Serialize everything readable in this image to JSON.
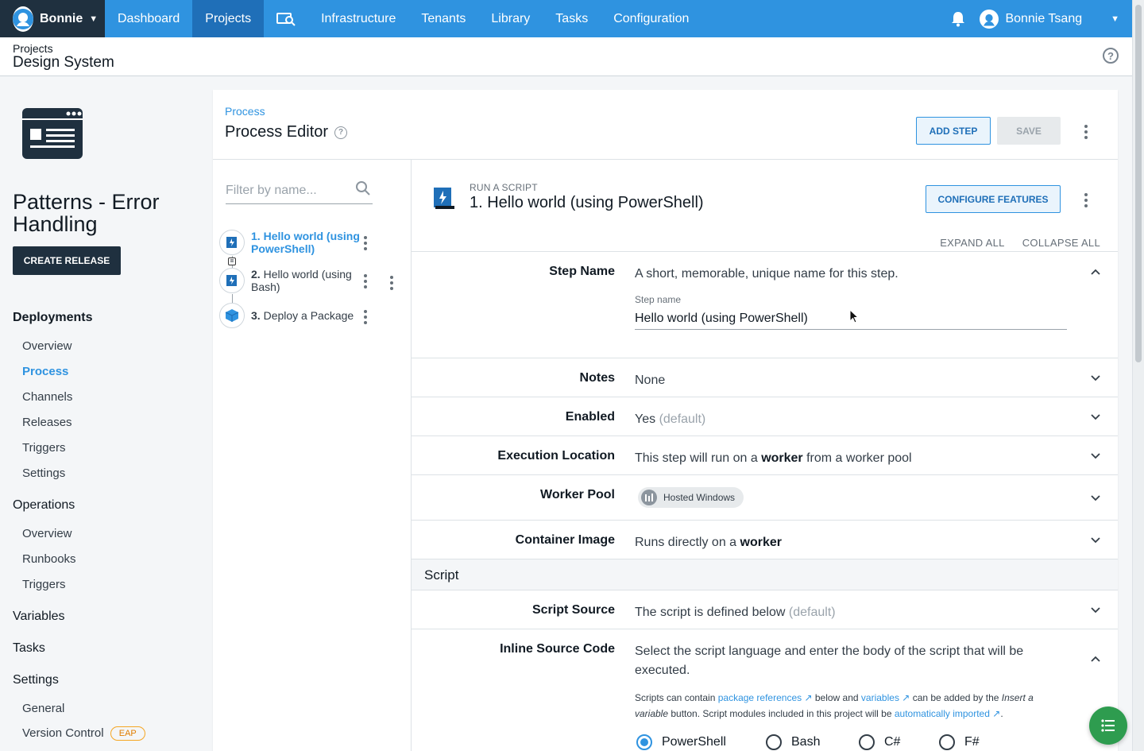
{
  "nav": {
    "brand": "Bonnie",
    "items": [
      {
        "label": "Dashboard"
      },
      {
        "label": "Projects"
      },
      {
        "label": "Infrastructure"
      },
      {
        "label": "Tenants"
      },
      {
        "label": "Library"
      },
      {
        "label": "Tasks"
      },
      {
        "label": "Configuration"
      }
    ],
    "search_icon": "search-machines-icon",
    "user_name": "Bonnie Tsang",
    "accent": "#2f93e0",
    "active_color": "#1f6fb8",
    "brand_bg": "#1f303f"
  },
  "header": {
    "crumb": "Projects",
    "title": "Design System"
  },
  "sidebar": {
    "project_title": "Patterns - Error Handling",
    "create_release": "CREATE RELEASE",
    "deployments": "Deployments",
    "deploy_items": [
      "Overview",
      "Process",
      "Channels",
      "Releases",
      "Triggers",
      "Settings"
    ],
    "operations": "Operations",
    "ops_items": [
      "Overview",
      "Runbooks",
      "Triggers"
    ],
    "variables": "Variables",
    "tasks": "Tasks",
    "settings": "Settings",
    "settings_items": [
      "General",
      "Version Control"
    ],
    "eap": "EAP"
  },
  "editor": {
    "crumb": "Process",
    "title": "Process Editor",
    "add_step": "ADD STEP",
    "save": "SAVE",
    "filter_placeholder": "Filter by name...",
    "steps": [
      {
        "num": "1.",
        "name": "Hello world (using PowerShell)"
      },
      {
        "num": "2.",
        "name": "Hello world (using Bash)"
      },
      {
        "num": "3.",
        "name": "Deploy a Package"
      }
    ],
    "run_label": "RUN A SCRIPT",
    "step_title": "1.  Hello world (using PowerShell)",
    "configure_features": "CONFIGURE FEATURES",
    "expand_all": "EXPAND ALL",
    "collapse_all": "COLLAPSE ALL",
    "step_name_label": "Step Name",
    "step_name_desc": "A short, memorable, unique name for this step.",
    "step_name_field_label": "Step name",
    "step_name_value": "Hello world (using PowerShell)",
    "notes_label": "Notes",
    "notes_value": "None",
    "enabled_label": "Enabled",
    "enabled_value": "Yes",
    "enabled_default": "(default)",
    "exec_label": "Execution Location",
    "exec_pre": "This step will run on a ",
    "exec_bold": "worker",
    "exec_post": " from a worker pool",
    "pool_label": "Worker Pool",
    "pool_value": "Hosted Windows",
    "container_label": "Container Image",
    "container_pre": "Runs directly on a ",
    "container_bold": "worker",
    "script_section": "Script",
    "source_label": "Script Source",
    "source_value": "The script is defined below",
    "source_default": "(default)",
    "inline_label": "Inline Source Code",
    "inline_desc": "Select the script language and enter the body of the script that will be executed.",
    "help_1": "Scripts can contain ",
    "help_link1": "package references",
    "help_2": " below and ",
    "help_link2": "variables",
    "help_3": " can be added by the ",
    "help_italic": "Insert a variable",
    "help_4": " button. Script modules included in this project will be ",
    "help_link3": "automatically imported",
    "help_5": ".",
    "languages": [
      "PowerShell",
      "Bash",
      "C#",
      "F#"
    ],
    "selected_language": "PowerShell"
  }
}
